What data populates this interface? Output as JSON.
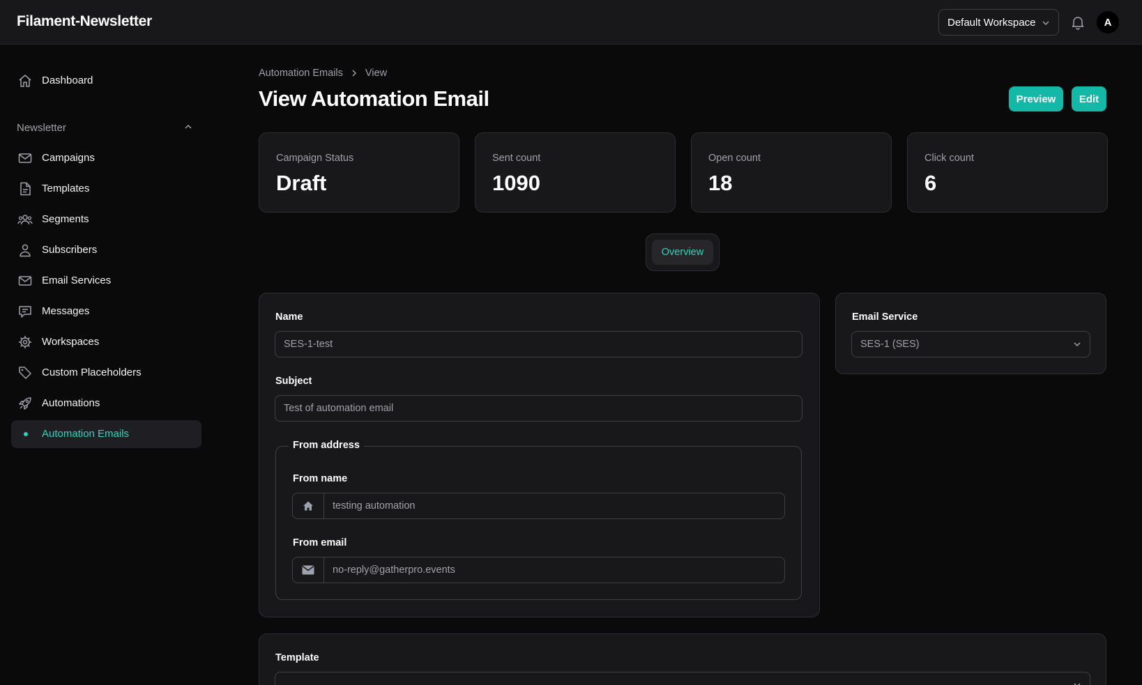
{
  "app": {
    "title": "Filament-Newsletter",
    "workspace": "Default Workspace",
    "avatar_initial": "A"
  },
  "sidebar": {
    "dashboard": "Dashboard",
    "group_label": "Newsletter",
    "items": [
      {
        "label": "Campaigns",
        "icon": "envelope-icon"
      },
      {
        "label": "Templates",
        "icon": "document-icon"
      },
      {
        "label": "Segments",
        "icon": "user-group-icon"
      },
      {
        "label": "Subscribers",
        "icon": "user-icon"
      },
      {
        "label": "Email Services",
        "icon": "envelope-icon"
      },
      {
        "label": "Messages",
        "icon": "chat-bubble-icon"
      },
      {
        "label": "Workspaces",
        "icon": "cog-icon"
      },
      {
        "label": "Custom Placeholders",
        "icon": "tag-icon"
      },
      {
        "label": "Automations",
        "icon": "rocket-icon"
      },
      {
        "label": "Automation Emails",
        "icon": "dot-icon",
        "active": true
      }
    ]
  },
  "breadcrumb": [
    "Automation Emails",
    "View"
  ],
  "page": {
    "title": "View Automation Email",
    "preview_label": "Preview",
    "edit_label": "Edit"
  },
  "stats": [
    {
      "label": "Campaign Status",
      "value": "Draft"
    },
    {
      "label": "Sent count",
      "value": "1090"
    },
    {
      "label": "Open count",
      "value": "18"
    },
    {
      "label": "Click count",
      "value": "6"
    }
  ],
  "tabs": [
    "Overview"
  ],
  "form": {
    "name_label": "Name",
    "name_value": "SES-1-test",
    "subject_label": "Subject",
    "subject_value": "Test of automation email",
    "from_address_legend": "From address",
    "from_name_label": "From name",
    "from_name_value": "testing automation",
    "from_email_label": "From email",
    "from_email_value": "no-reply@gatherpro.events",
    "email_service_label": "Email Service",
    "email_service_value": "SES-1 (SES)",
    "template_label": "Template"
  },
  "colors": {
    "accent": "#14b8a6",
    "accent_text": "#2dd4bf",
    "background": "#0a0a0b",
    "card": "#18181b"
  }
}
